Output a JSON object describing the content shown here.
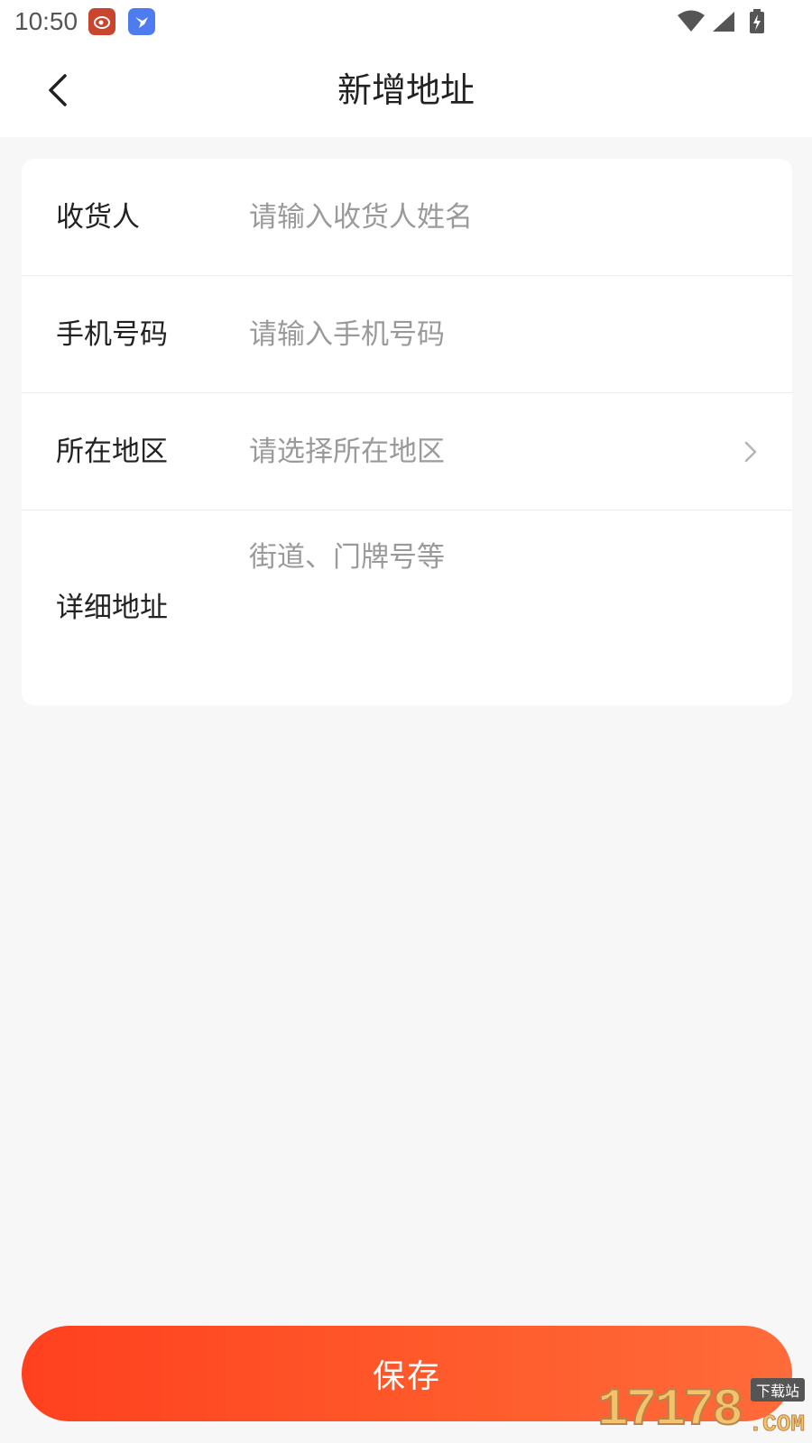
{
  "status_bar": {
    "time": "10:50",
    "app_icons": [
      "weibo-icon",
      "bird-icon"
    ],
    "system_icons": [
      "wifi-icon",
      "cellular-signal-icon",
      "battery-charging-icon"
    ]
  },
  "header": {
    "title": "新增地址",
    "back_icon": "chevron-left-icon"
  },
  "form": {
    "receiver": {
      "label": "收货人",
      "value": "",
      "placeholder": "请输入收货人姓名"
    },
    "phone": {
      "label": "手机号码",
      "value": "",
      "placeholder": "请输入手机号码"
    },
    "region": {
      "label": "所在地区",
      "placeholder": "请选择所在地区",
      "icon": "chevron-right-icon"
    },
    "detail": {
      "label": "详细地址",
      "value": "",
      "placeholder": "街道、门牌号等"
    }
  },
  "save_button": {
    "label": "保存"
  },
  "watermark": {
    "digits": "17178",
    "domain": ".COM",
    "tag": "下载站"
  },
  "colors": {
    "accent_start": "#ff401f",
    "accent_end": "#ff6b3a",
    "page_background": "#f7f7f7",
    "card_background": "#ffffff",
    "placeholder_text": "#9a9a9a",
    "primary_text": "#222222"
  }
}
